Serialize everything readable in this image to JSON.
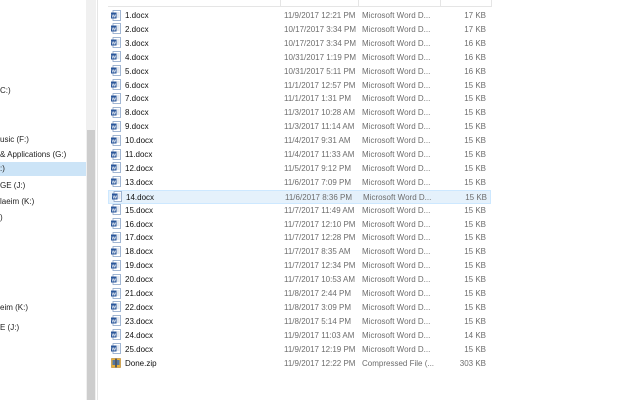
{
  "nav_pane": {
    "items": [
      {
        "label": "C:)",
        "selected": false
      },
      {
        "label": "usic (F:)",
        "selected": false
      },
      {
        "label": "& Applications (G:)",
        "selected": false
      },
      {
        "label": ":)",
        "selected": true
      },
      {
        "label": "GE (J:)",
        "selected": false
      },
      {
        "label": "laeim (K:)",
        "selected": false
      },
      {
        "label": ")",
        "selected": false
      },
      {
        "label": "eim (K:)",
        "selected": false
      },
      {
        "label": "E (J:)",
        "selected": false
      }
    ]
  },
  "file_list": {
    "rows": [
      {
        "name": "1.docx",
        "date": "11/9/2017 12:21 PM",
        "type": "Microsoft Word D...",
        "size": "17 KB",
        "icon": "word-document-icon"
      },
      {
        "name": "2.docx",
        "date": "10/17/2017 3:34 PM",
        "type": "Microsoft Word D...",
        "size": "17 KB",
        "icon": "word-document-icon"
      },
      {
        "name": "3.docx",
        "date": "10/17/2017 3:34 PM",
        "type": "Microsoft Word D...",
        "size": "16 KB",
        "icon": "word-document-icon"
      },
      {
        "name": "4.docx",
        "date": "10/31/2017 1:19 PM",
        "type": "Microsoft Word D...",
        "size": "16 KB",
        "icon": "word-document-icon"
      },
      {
        "name": "5.docx",
        "date": "10/31/2017 5:11 PM",
        "type": "Microsoft Word D...",
        "size": "16 KB",
        "icon": "word-document-icon"
      },
      {
        "name": "6.docx",
        "date": "11/1/2017 12:57 PM",
        "type": "Microsoft Word D...",
        "size": "15 KB",
        "icon": "word-document-icon"
      },
      {
        "name": "7.docx",
        "date": "11/1/2017 1:31 PM",
        "type": "Microsoft Word D...",
        "size": "15 KB",
        "icon": "word-document-icon"
      },
      {
        "name": "8.docx",
        "date": "11/3/2017 10:28 AM",
        "type": "Microsoft Word D...",
        "size": "15 KB",
        "icon": "word-document-icon"
      },
      {
        "name": "9.docx",
        "date": "11/3/2017 11:14 AM",
        "type": "Microsoft Word D...",
        "size": "15 KB",
        "icon": "word-document-icon"
      },
      {
        "name": "10.docx",
        "date": "11/4/2017 9:31 AM",
        "type": "Microsoft Word D...",
        "size": "15 KB",
        "icon": "word-document-icon"
      },
      {
        "name": "11.docx",
        "date": "11/4/2017 11:33 AM",
        "type": "Microsoft Word D...",
        "size": "15 KB",
        "icon": "word-document-icon"
      },
      {
        "name": "12.docx",
        "date": "11/5/2017 9:12 PM",
        "type": "Microsoft Word D...",
        "size": "15 KB",
        "icon": "word-document-icon"
      },
      {
        "name": "13.docx",
        "date": "11/6/2017 7:09 PM",
        "type": "Microsoft Word D...",
        "size": "15 KB",
        "icon": "word-document-icon"
      },
      {
        "name": "14.docx",
        "date": "11/6/2017 8:36 PM",
        "type": "Microsoft Word D...",
        "size": "15 KB",
        "icon": "word-document-icon",
        "selected": true
      },
      {
        "name": "15.docx",
        "date": "11/7/2017 11:49 AM",
        "type": "Microsoft Word D...",
        "size": "15 KB",
        "icon": "word-document-icon"
      },
      {
        "name": "16.docx",
        "date": "11/7/2017 12:10 PM",
        "type": "Microsoft Word D...",
        "size": "15 KB",
        "icon": "word-document-icon"
      },
      {
        "name": "17.docx",
        "date": "11/7/2017 12:28 PM",
        "type": "Microsoft Word D...",
        "size": "15 KB",
        "icon": "word-document-icon"
      },
      {
        "name": "18.docx",
        "date": "11/7/2017 8:35 AM",
        "type": "Microsoft Word D...",
        "size": "15 KB",
        "icon": "word-document-icon"
      },
      {
        "name": "19.docx",
        "date": "11/7/2017 12:34 PM",
        "type": "Microsoft Word D...",
        "size": "15 KB",
        "icon": "word-document-icon"
      },
      {
        "name": "20.docx",
        "date": "11/7/2017 10:53 AM",
        "type": "Microsoft Word D...",
        "size": "15 KB",
        "icon": "word-document-icon"
      },
      {
        "name": "21.docx",
        "date": "11/8/2017 2:44 PM",
        "type": "Microsoft Word D...",
        "size": "15 KB",
        "icon": "word-document-icon"
      },
      {
        "name": "22.docx",
        "date": "11/8/2017 3:09 PM",
        "type": "Microsoft Word D...",
        "size": "15 KB",
        "icon": "word-document-icon"
      },
      {
        "name": "23.docx",
        "date": "11/8/2017 5:14 PM",
        "type": "Microsoft Word D...",
        "size": "15 KB",
        "icon": "word-document-icon"
      },
      {
        "name": "24.docx",
        "date": "11/9/2017 11:03 AM",
        "type": "Microsoft Word D...",
        "size": "14 KB",
        "icon": "word-document-icon"
      },
      {
        "name": "25.docx",
        "date": "11/9/2017 12:19 PM",
        "type": "Microsoft Word D...",
        "size": "15 KB",
        "icon": "word-document-icon"
      },
      {
        "name": "Done.zip",
        "date": "11/9/2017 12:22 PM",
        "type": "Compressed File (...",
        "size": "303 KB",
        "icon": "zip-archive-icon"
      }
    ]
  },
  "colors": {
    "selection_fill": "#cce4f7",
    "row_selected_fill": "#e5f1fb",
    "word_blue": "#2b579a",
    "zip_yellow": "#e8b13b"
  }
}
